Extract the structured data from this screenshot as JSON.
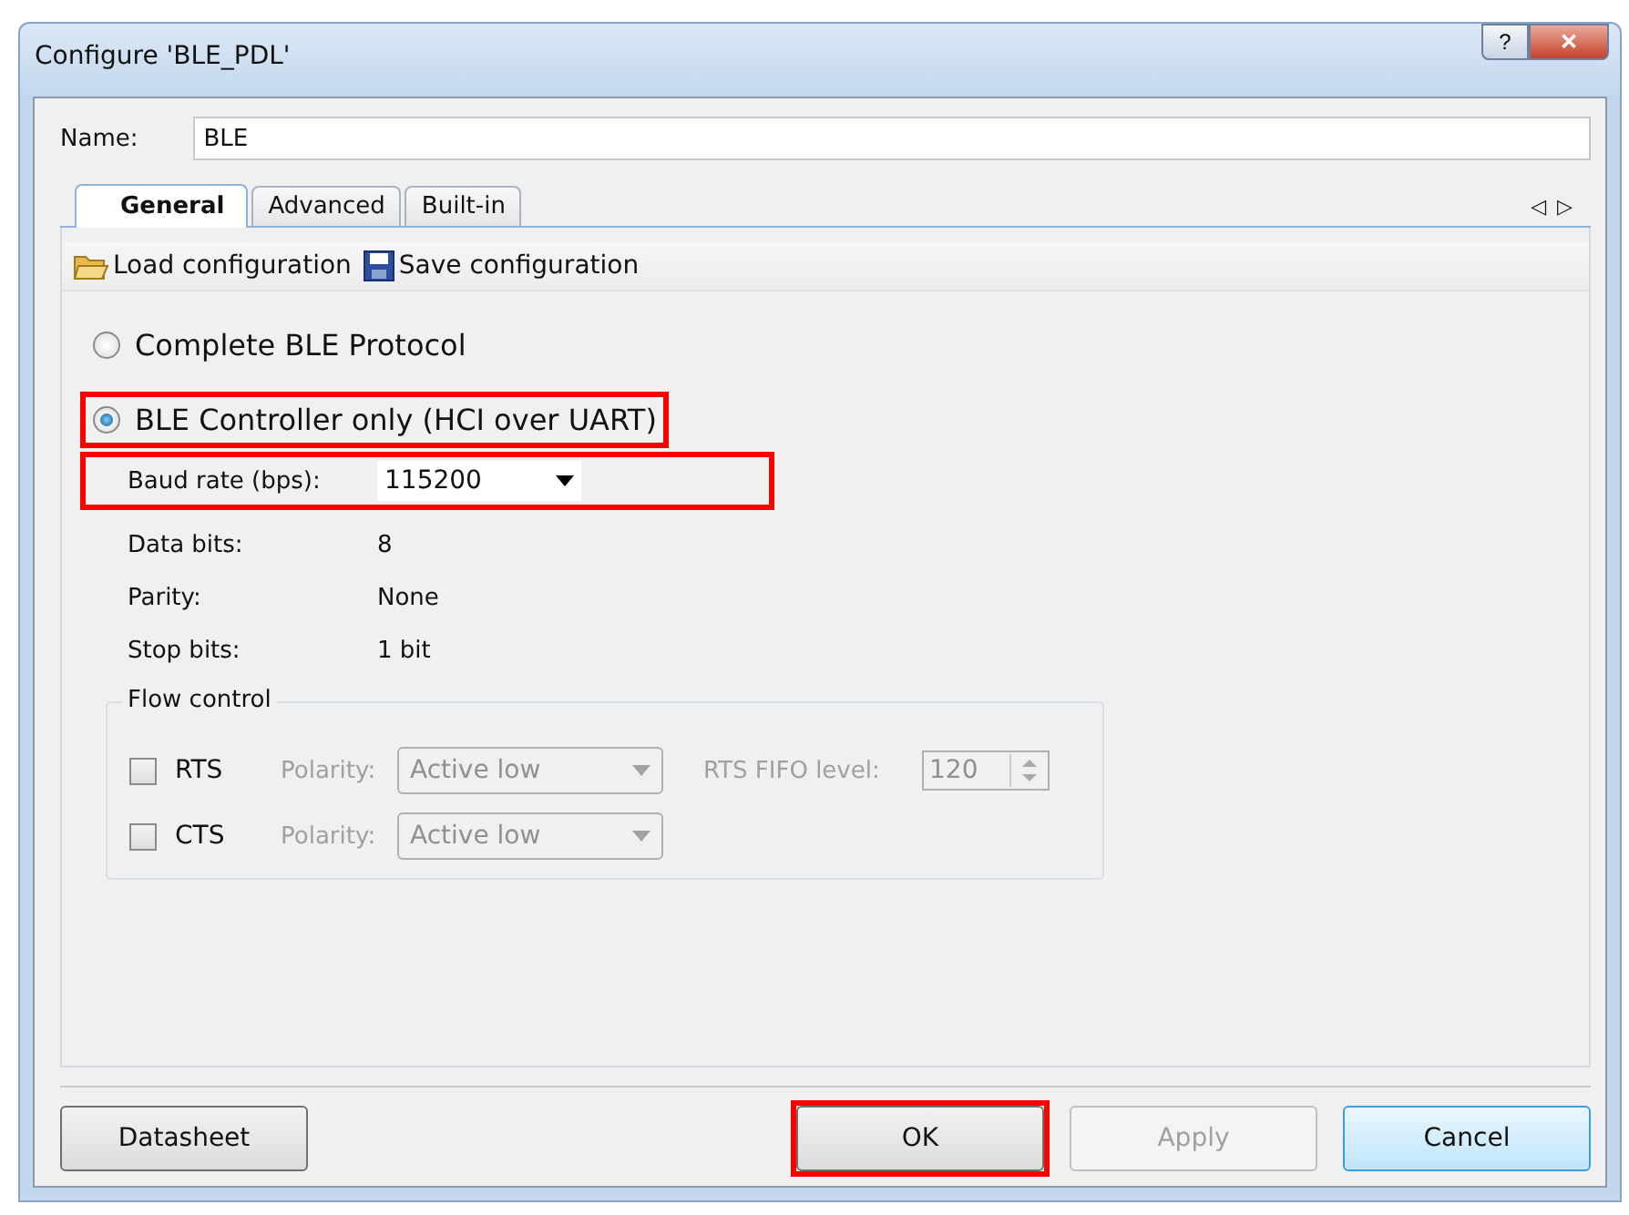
{
  "window": {
    "title": "Configure 'BLE_PDL'",
    "help_button": "?",
    "close_button": "✕"
  },
  "name_field": {
    "label": "Name:",
    "value": "BLE"
  },
  "tabs": [
    {
      "label": "General",
      "selected": true
    },
    {
      "label": "Advanced",
      "selected": false
    },
    {
      "label": "Built-in",
      "selected": false
    }
  ],
  "tab_scroll": {
    "left": "◁",
    "right": "▷"
  },
  "toolbar": [
    {
      "label": "Load configuration",
      "kind": "load"
    },
    {
      "label": "Save configuration",
      "kind": "save"
    }
  ],
  "mode_options": [
    {
      "label": "Complete BLE Protocol",
      "selected": false,
      "highlighted": false
    },
    {
      "label": "BLE Controller only (HCI over UART)",
      "selected": true,
      "highlighted": true
    }
  ],
  "baud_rate": {
    "label": "Baud rate (bps):",
    "value": "115200",
    "highlighted": true
  },
  "settings": [
    {
      "label": "Data bits:",
      "value": "8"
    },
    {
      "label": "Parity:",
      "value": "None"
    },
    {
      "label": "Stop bits:",
      "value": "1 bit"
    }
  ],
  "flow_control": {
    "title": "Flow control",
    "rows": [
      {
        "label": "RTS",
        "checked": false,
        "polarity_label": "Polarity:",
        "polarity": "Active low",
        "fifo_label": "RTS FIFO level:",
        "fifo_value": "120"
      },
      {
        "label": "CTS",
        "checked": false,
        "polarity_label": "Polarity:",
        "polarity": "Active low"
      }
    ]
  },
  "buttons": [
    {
      "label": "Datasheet",
      "kind": "left",
      "disabled": false,
      "default": false
    },
    {
      "label": "OK",
      "kind": "right",
      "disabled": false,
      "highlighted": true,
      "default": false
    },
    {
      "label": "Apply",
      "kind": "right",
      "disabled": true,
      "default": false
    },
    {
      "label": "Cancel",
      "kind": "right",
      "disabled": false,
      "default": true
    }
  ]
}
